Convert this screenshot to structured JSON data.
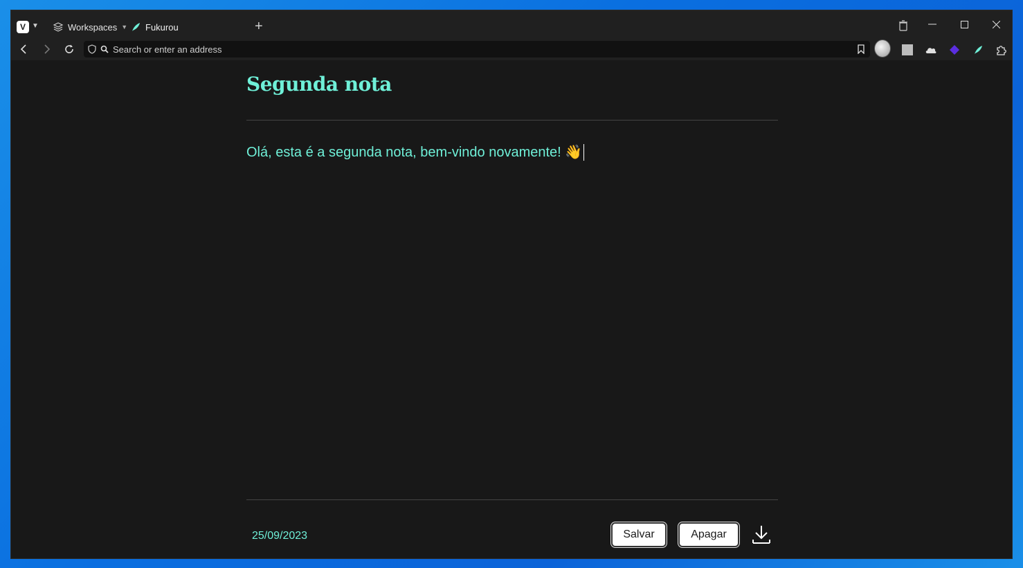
{
  "browser": {
    "workspaces_label": "Workspaces",
    "tab_title": "Fukurou",
    "address_placeholder": "Search or enter an address"
  },
  "note": {
    "title": "Segunda nota",
    "body": "Olá, esta é a segunda nota, bem-vindo novamente! 👋",
    "date": "25/09/2023"
  },
  "actions": {
    "save_label": "Salvar",
    "delete_label": "Apagar"
  },
  "colors": {
    "accent": "#6ff0d8",
    "background": "#181818"
  }
}
